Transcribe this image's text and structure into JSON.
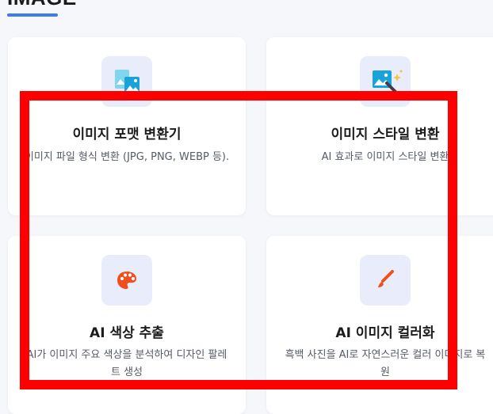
{
  "section": {
    "title": "IMAGE"
  },
  "cards": [
    {
      "title": "이미지 포맷 변환기",
      "desc": "이미지 파일 형식 변환 (JPG, PNG, WEBP 등).",
      "icon": "image-convert-icon"
    },
    {
      "title": "이미지 스타일 변환",
      "desc": "AI 효과로 이미지 스타일 변환",
      "icon": "image-style-icon"
    },
    {
      "title": "AI 색상 추출",
      "desc": "AI가 이미지 주요 색상을 분석하여 디자인 팔레트 생성",
      "icon": "palette-icon"
    },
    {
      "title": "AI 이미지 컬러화",
      "desc": "흑백 사진을 AI로 자연스러운 컬러 이미지로 복원",
      "icon": "brush-icon"
    }
  ],
  "colors": {
    "accent": "#3b7cf0",
    "highlight": "#ff0000",
    "icon_bg": "#e9edfb",
    "icon_orange": "#f0501e"
  }
}
